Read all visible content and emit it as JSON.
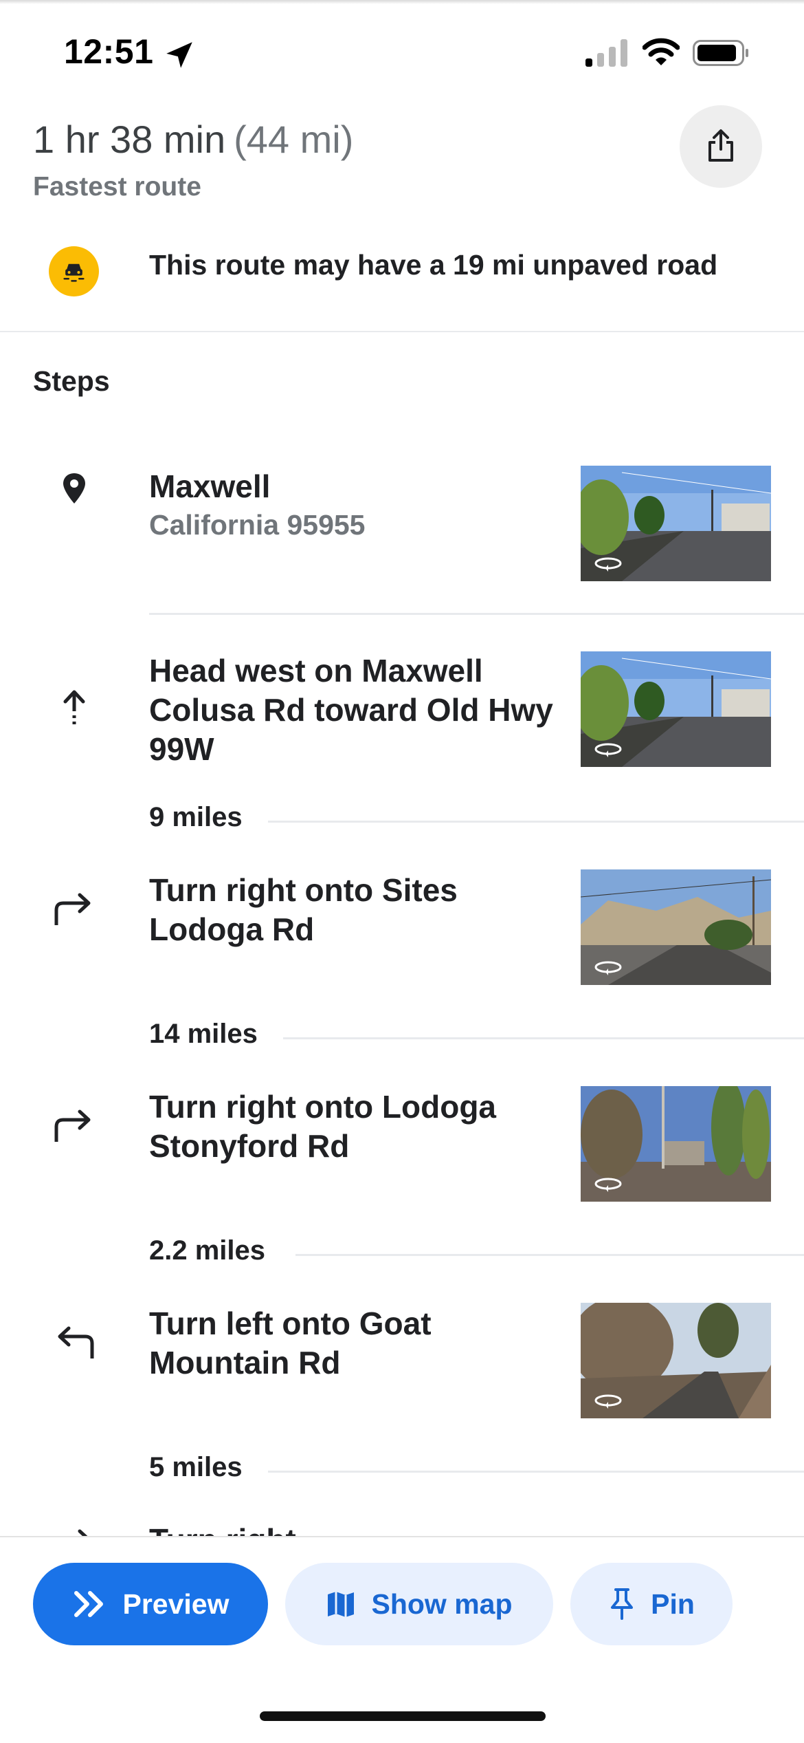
{
  "status_bar": {
    "time": "12:51"
  },
  "summary": {
    "duration": "1 hr 38 min",
    "distance": "(44 mi)",
    "route_type": "Fastest route"
  },
  "warning": {
    "text": "This route may have a 19 mi unpaved road",
    "icon": "unpaved-road-icon"
  },
  "steps_title": "Steps",
  "steps": [
    {
      "icon": "location-pin-icon",
      "title": "Maxwell",
      "subtitle": "California 95955"
    },
    {
      "icon": "straight-arrow-icon",
      "title": "Head west on Maxwell Colusa Rd toward Old Hwy 99W",
      "distance_after": "9 miles"
    },
    {
      "icon": "turn-right-icon",
      "title": "Turn right onto Sites Lodoga Rd",
      "distance_after": "14 miles"
    },
    {
      "icon": "turn-right-icon",
      "title": "Turn right onto Lodoga Stonyford Rd",
      "distance_after": "2.2 miles"
    },
    {
      "icon": "turn-left-icon",
      "title": "Turn left onto Goat Mountain Rd",
      "distance_after": "5 miles"
    },
    {
      "icon": "turn-right-icon",
      "title": "Turn right"
    }
  ],
  "actions": {
    "preview": "Preview",
    "show_map": "Show map",
    "pin": "Pin"
  },
  "colors": {
    "accent": "#1a73e8",
    "accent_soft": "#e8f0fe",
    "warning": "#fbbc04"
  }
}
